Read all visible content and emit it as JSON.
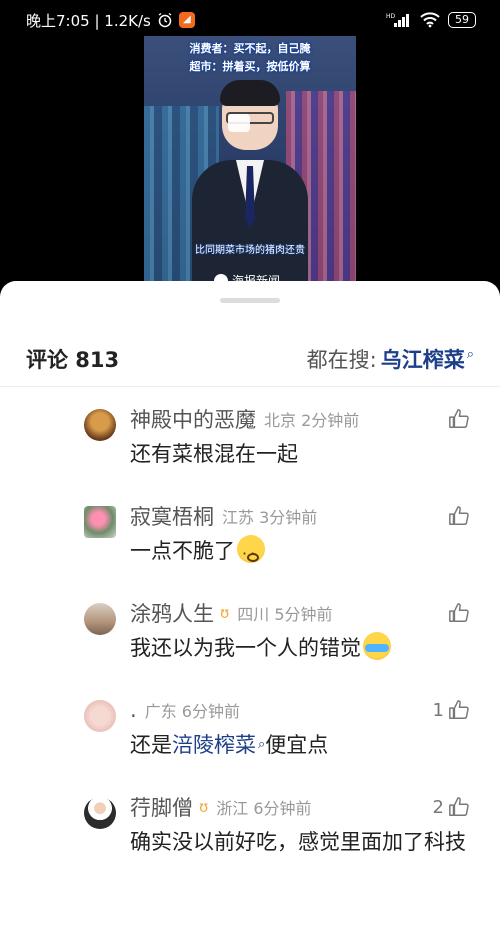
{
  "status_bar": {
    "time_speed": "晚上7:05 | 1.2K/s",
    "app_badge": "◢",
    "hd": "HD",
    "battery": "59"
  },
  "video": {
    "caption_line1": "消费者：买不起，自己腌",
    "caption_line2": "超市：拼着买，按低价算",
    "subtitle": "比同期菜市场的猪肉还贵",
    "logo_text": "海报新闻"
  },
  "comments_panel": {
    "count_label": "评论 813",
    "trending_prefix": "都在搜:",
    "trending_term": "乌江榨菜",
    "search_glyph": "⌕"
  },
  "comments": [
    {
      "username": "神殿中的恶魔",
      "vip": "",
      "location_time": "北京 2分钟前",
      "likes": "",
      "text": "还有菜根混在一起",
      "avatar_color": "#7a4a2a"
    },
    {
      "username": "寂寞梧桐",
      "vip": "",
      "location_time": "江苏 3分钟前",
      "likes": "",
      "text": "一点不脆了",
      "avatar_color": "#c68aa0"
    },
    {
      "username": "涂鸦人生",
      "vip": "ʊ",
      "location_time": "四川 5分钟前",
      "likes": "",
      "text": "我还以为我一个人的错觉",
      "avatar_color": "#b49a86"
    },
    {
      "username": ".",
      "vip": "",
      "location_time": "广东 6分钟前",
      "likes": "1",
      "text_before": "还是",
      "text_link": "涪陵榨菜",
      "text_after": "便宜点",
      "avatar_color": "#e9c6c0"
    },
    {
      "username": "荇脚僧",
      "vip": "ʊ",
      "location_time": "浙江 6分钟前",
      "likes": "2",
      "text": "确实没以前好吃，感觉里面加了科技",
      "avatar_color": "#2b2b2b"
    }
  ],
  "colors": {
    "accent_blue": "#1d3f8a",
    "vip_gold": "#f2a93b"
  }
}
